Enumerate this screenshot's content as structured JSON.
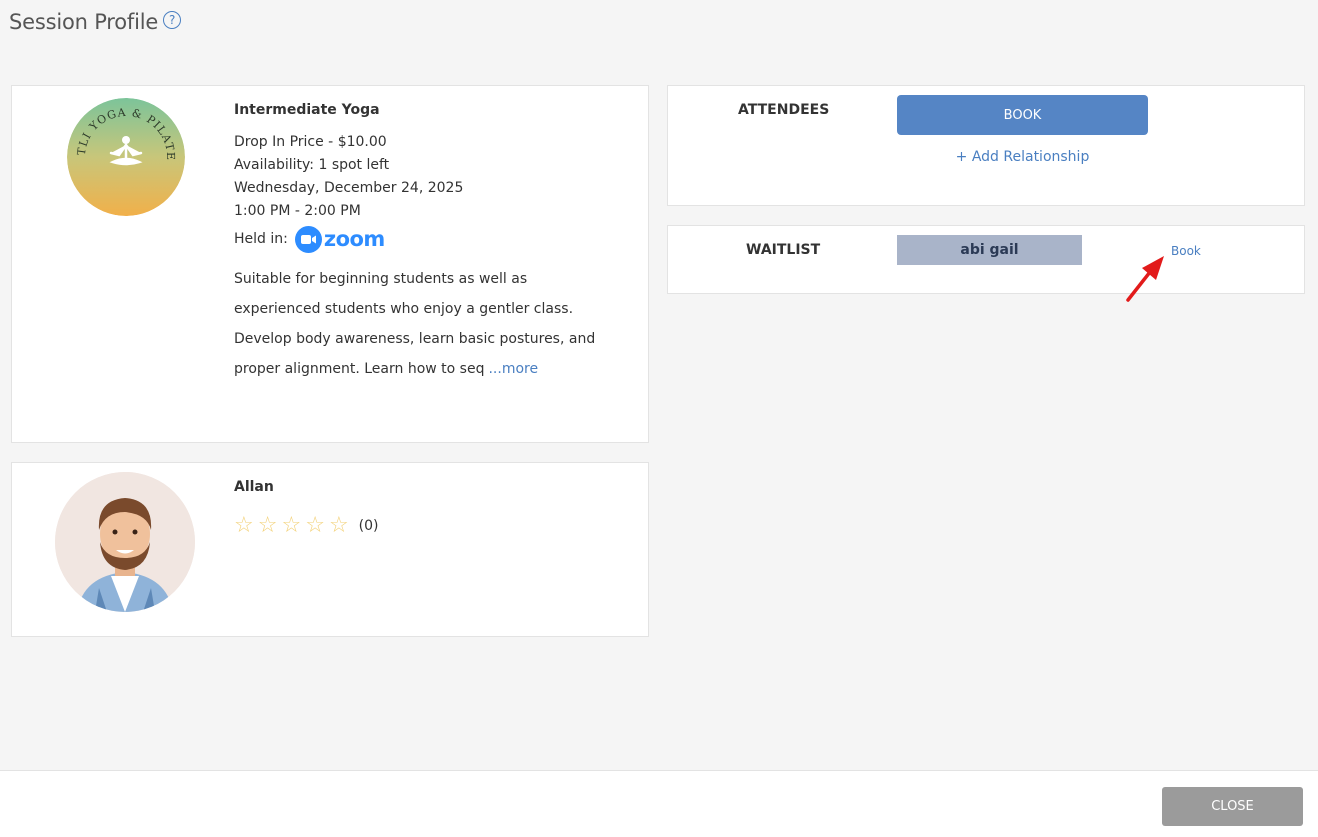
{
  "header": {
    "title": "Session Profile",
    "help_icon": "question-circle-icon"
  },
  "session": {
    "logo_icon": "yoga-studio-logo",
    "name": "Intermediate Yoga",
    "price": "Drop In Price - $10.00",
    "availability": "Availability: 1 spot left",
    "date": "Wednesday, December 24, 2025",
    "time": "1:00 PM - 2:00 PM",
    "held_in_label": "Held in:",
    "venue_logo": "zoom",
    "description": "Suitable for beginning students as well as experienced students who enjoy a gentler class. Develop body awareness, learn basic postures, and proper alignment. Learn how to seq",
    "more_label": "...more"
  },
  "instructor": {
    "avatar_icon": "instructor-avatar",
    "name": "Allan",
    "rating_stars": 0,
    "rating_max": 5,
    "rating_count": "(0)"
  },
  "attendees": {
    "label": "ATTENDEES",
    "book_label": "BOOK",
    "add_relationship_label": "+ Add Relationship"
  },
  "waitlist": {
    "label": "WAITLIST",
    "entries": [
      {
        "name": "abi gail",
        "book_label": "Book"
      }
    ]
  },
  "footer": {
    "close_label": "CLOSE"
  },
  "colors": {
    "primary_button": "#5585c5",
    "link": "#4a7fc1",
    "waitlist_chip": "#a9b4c9",
    "close_button": "#9b9b9b",
    "annotation_arrow": "#e21b1b",
    "star": "#f3d27a"
  }
}
